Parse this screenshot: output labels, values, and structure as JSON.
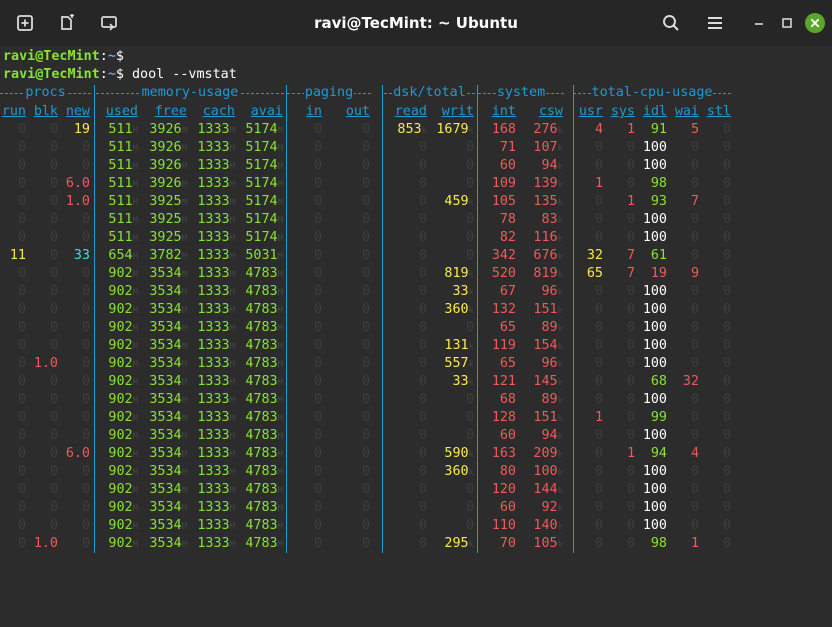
{
  "window": {
    "title": "ravi@TecMint: ~ Ubuntu"
  },
  "prompt": {
    "user_host": "ravi@TecMint",
    "separator": ":",
    "path": "~",
    "symbol": "$",
    "command": "dool --vmstat"
  },
  "groups": [
    {
      "label": "procs",
      "col_start": 0,
      "col_end": 2
    },
    {
      "label": "memory-usage",
      "col_start": 3,
      "col_end": 6
    },
    {
      "label": "paging",
      "col_start": 7,
      "col_end": 8
    },
    {
      "label": "dsk/total",
      "col_start": 9,
      "col_end": 10
    },
    {
      "label": "system",
      "col_start": 11,
      "col_end": 12
    },
    {
      "label": "total-cpu-usage",
      "col_start": 13,
      "col_end": 17
    }
  ],
  "columns": [
    "run",
    "blk",
    "new",
    "used",
    "free",
    "cach",
    "avai",
    "in",
    "out",
    "read",
    "writ",
    "int",
    "csw",
    "usr",
    "sys",
    "idl",
    "wai",
    "stl"
  ],
  "rows": [
    [
      "0",
      "0",
      "19",
      "511",
      "3926",
      "1333",
      "5174",
      "0",
      "0",
      "853",
      "1679",
      "168",
      "276",
      "4",
      "1",
      "91",
      "5",
      "0"
    ],
    [
      "0",
      "0",
      "0",
      "511",
      "3926",
      "1333",
      "5174",
      "0",
      "0",
      "0",
      "0",
      "71",
      "107",
      "0",
      "0",
      "100",
      "0",
      "0"
    ],
    [
      "0",
      "0",
      "0",
      "511",
      "3926",
      "1333",
      "5174",
      "0",
      "0",
      "0",
      "0",
      "60",
      "94",
      "0",
      "0",
      "100",
      "0",
      "0"
    ],
    [
      "0",
      "0",
      "6.0",
      "511",
      "3926",
      "1333",
      "5174",
      "0",
      "0",
      "0",
      "0",
      "109",
      "139",
      "1",
      "0",
      "98",
      "0",
      "0"
    ],
    [
      "0",
      "0",
      "1.0",
      "511",
      "3925",
      "1333",
      "5174",
      "0",
      "0",
      "0",
      "459",
      "105",
      "135",
      "0",
      "1",
      "93",
      "7",
      "0"
    ],
    [
      "0",
      "0",
      "0",
      "511",
      "3925",
      "1333",
      "5174",
      "0",
      "0",
      "0",
      "0",
      "78",
      "83",
      "0",
      "0",
      "100",
      "0",
      "0"
    ],
    [
      "0",
      "0",
      "0",
      "511",
      "3925",
      "1333",
      "5174",
      "0",
      "0",
      "0",
      "0",
      "82",
      "116",
      "0",
      "0",
      "100",
      "0",
      "0"
    ],
    [
      "11",
      "0",
      "33",
      "654",
      "3782",
      "1333",
      "5031",
      "0",
      "0",
      "0",
      "0",
      "342",
      "676",
      "32",
      "7",
      "61",
      "0",
      "0"
    ],
    [
      "0",
      "0",
      "0",
      "902",
      "3534",
      "1333",
      "4783",
      "0",
      "0",
      "0",
      "819",
      "520",
      "819",
      "65",
      "7",
      "19",
      "9",
      "0"
    ],
    [
      "0",
      "0",
      "0",
      "902",
      "3534",
      "1333",
      "4783",
      "0",
      "0",
      "0",
      "33",
      "67",
      "96",
      "0",
      "0",
      "100",
      "0",
      "0"
    ],
    [
      "0",
      "0",
      "0",
      "902",
      "3534",
      "1333",
      "4783",
      "0",
      "0",
      "0",
      "360",
      "132",
      "151",
      "0",
      "0",
      "100",
      "0",
      "0"
    ],
    [
      "0",
      "0",
      "0",
      "902",
      "3534",
      "1333",
      "4783",
      "0",
      "0",
      "0",
      "0",
      "65",
      "89",
      "0",
      "0",
      "100",
      "0",
      "0"
    ],
    [
      "0",
      "0",
      "0",
      "902",
      "3534",
      "1333",
      "4783",
      "0",
      "0",
      "0",
      "131",
      "119",
      "154",
      "0",
      "0",
      "100",
      "0",
      "0"
    ],
    [
      "0",
      "1.0",
      "0",
      "902",
      "3534",
      "1333",
      "4783",
      "0",
      "0",
      "0",
      "557",
      "65",
      "96",
      "0",
      "0",
      "100",
      "0",
      "0"
    ],
    [
      "0",
      "0",
      "0",
      "902",
      "3534",
      "1333",
      "4783",
      "0",
      "0",
      "0",
      "33",
      "121",
      "145",
      "0",
      "0",
      "68",
      "32",
      "0"
    ],
    [
      "0",
      "0",
      "0",
      "902",
      "3534",
      "1333",
      "4783",
      "0",
      "0",
      "0",
      "0",
      "68",
      "89",
      "0",
      "0",
      "100",
      "0",
      "0"
    ],
    [
      "0",
      "0",
      "0",
      "902",
      "3534",
      "1333",
      "4783",
      "0",
      "0",
      "0",
      "0",
      "128",
      "151",
      "1",
      "0",
      "99",
      "0",
      "0"
    ],
    [
      "0",
      "0",
      "0",
      "902",
      "3534",
      "1333",
      "4783",
      "0",
      "0",
      "0",
      "0",
      "60",
      "94",
      "0",
      "0",
      "100",
      "0",
      "0"
    ],
    [
      "0",
      "0",
      "6.0",
      "902",
      "3534",
      "1333",
      "4783",
      "0",
      "0",
      "0",
      "590",
      "163",
      "209",
      "0",
      "1",
      "94",
      "4",
      "0"
    ],
    [
      "0",
      "0",
      "0",
      "902",
      "3534",
      "1333",
      "4783",
      "0",
      "0",
      "0",
      "360",
      "80",
      "100",
      "0",
      "0",
      "100",
      "0",
      "0"
    ],
    [
      "0",
      "0",
      "0",
      "902",
      "3534",
      "1333",
      "4783",
      "0",
      "0",
      "0",
      "0",
      "120",
      "144",
      "0",
      "0",
      "100",
      "0",
      "0"
    ],
    [
      "0",
      "0",
      "0",
      "902",
      "3534",
      "1333",
      "4783",
      "0",
      "0",
      "0",
      "0",
      "60",
      "92",
      "0",
      "0",
      "100",
      "0",
      "0"
    ],
    [
      "0",
      "0",
      "0",
      "902",
      "3534",
      "1333",
      "4783",
      "0",
      "0",
      "0",
      "0",
      "110",
      "140",
      "0",
      "0",
      "100",
      "0",
      "0"
    ],
    [
      "0",
      "1.0",
      "0",
      "902",
      "3534",
      "1333",
      "4783",
      "0",
      "0",
      "0",
      "295",
      "70",
      "105",
      "0",
      "0",
      "98",
      "1",
      "0"
    ]
  ],
  "colors": {
    "accent": "#1f9ad3",
    "zero": "#3e3e3e",
    "yellow": "#fce94f",
    "red": "#ef5a5a",
    "green": "#8ae234",
    "cyan": "#34e2e2",
    "white": "#ffffff"
  }
}
